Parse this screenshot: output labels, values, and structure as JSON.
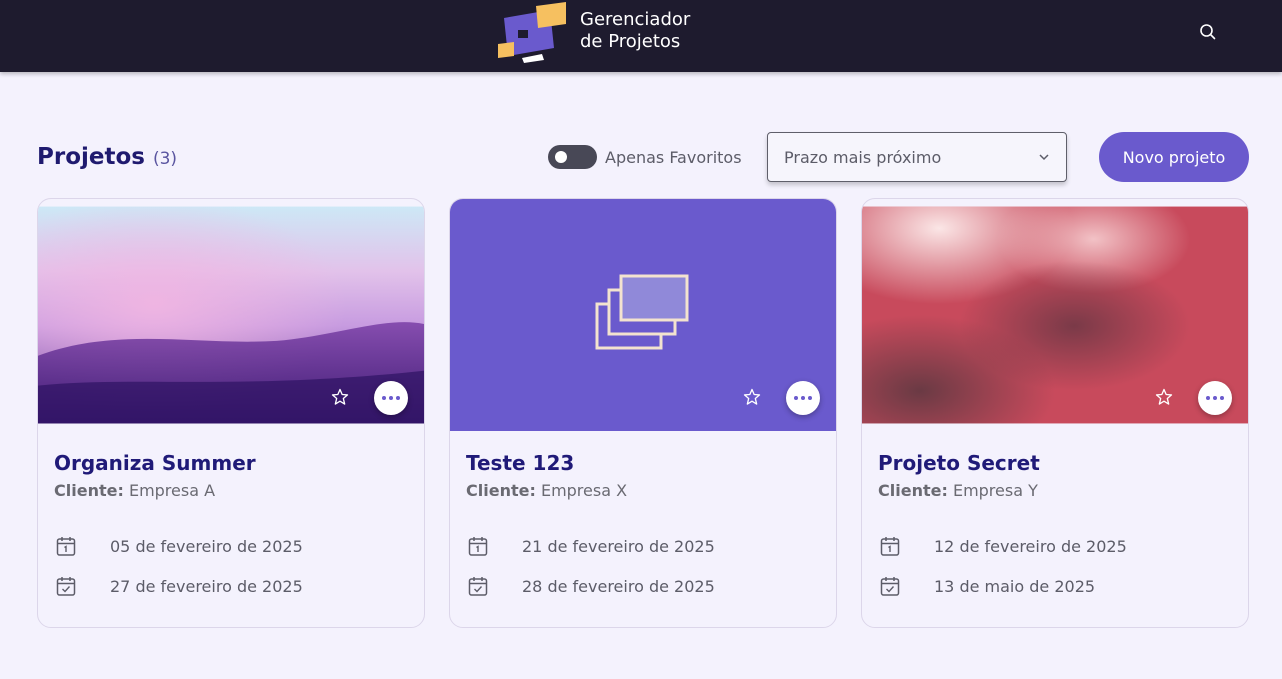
{
  "app": {
    "title_line1": "Gerenciador",
    "title_line2": "de Projetos"
  },
  "header": {
    "search_icon": "search-icon"
  },
  "page": {
    "title": "Projetos",
    "count": "(3)"
  },
  "filters": {
    "favorites_toggle_label": "Apenas Favoritos",
    "favorites_toggle_on": false,
    "sort_selected": "Prazo mais próximo"
  },
  "actions": {
    "new_project_label": "Novo projeto"
  },
  "projects": [
    {
      "name": "Organiza Summer",
      "client_label": "Cliente:",
      "client": "Empresa A",
      "start_date": "05 de fevereiro de 2025",
      "end_date": "27 de fevereiro de 2025",
      "cover": "pastel-landscape-image"
    },
    {
      "name": "Teste 123",
      "client_label": "Cliente:",
      "client": "Empresa X",
      "start_date": "21 de fevereiro de 2025",
      "end_date": "28 de fevereiro de 2025",
      "cover": "placeholder-gallery-icon"
    },
    {
      "name": "Projeto Secret",
      "client_label": "Cliente:",
      "client": "Empresa Y",
      "start_date": "12 de fevereiro de 2025",
      "end_date": "13 de maio de 2025",
      "cover": "red-abstract-image"
    }
  ],
  "colors": {
    "header_bg": "#1e1b2e",
    "page_bg": "#f4f2fd",
    "accent": "#6a5acd",
    "title": "#201a78"
  }
}
